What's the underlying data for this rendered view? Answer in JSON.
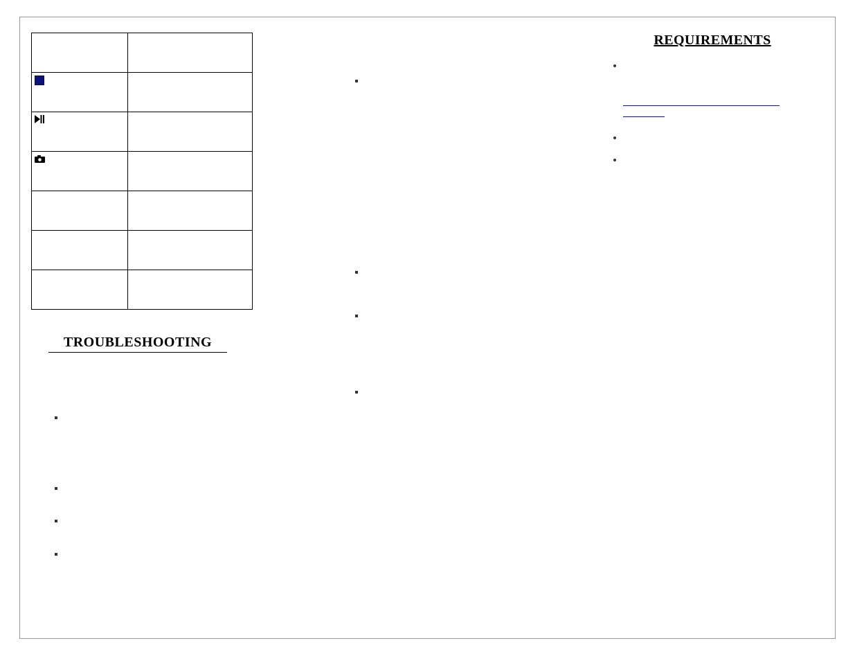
{
  "left": {
    "table": {
      "rows": [
        {
          "icon": "",
          "label": "",
          "desc": ""
        },
        {
          "icon": "stop",
          "label": "",
          "desc": ""
        },
        {
          "icon": "playpause",
          "label": "",
          "desc": ""
        },
        {
          "icon": "camera",
          "label": "",
          "desc": ""
        },
        {
          "icon": "",
          "label": "",
          "desc": ""
        },
        {
          "icon": "",
          "label": "",
          "desc": ""
        },
        {
          "icon": "",
          "label": "",
          "desc": ""
        }
      ]
    },
    "troubleshooting": {
      "title": "TROUBLESHOOTING",
      "items": [
        {
          "text": ""
        },
        {
          "text": ""
        },
        {
          "text": ""
        },
        {
          "text": ""
        }
      ]
    }
  },
  "middle": {
    "items": [
      {
        "text": ""
      },
      {
        "text": ""
      },
      {
        "text": ""
      },
      {
        "text": ""
      }
    ]
  },
  "right": {
    "title": "REQUIREMENTS",
    "items": [
      {
        "text": "",
        "link1": "",
        "link2": ""
      },
      {
        "text": ""
      },
      {
        "text": ""
      }
    ]
  }
}
